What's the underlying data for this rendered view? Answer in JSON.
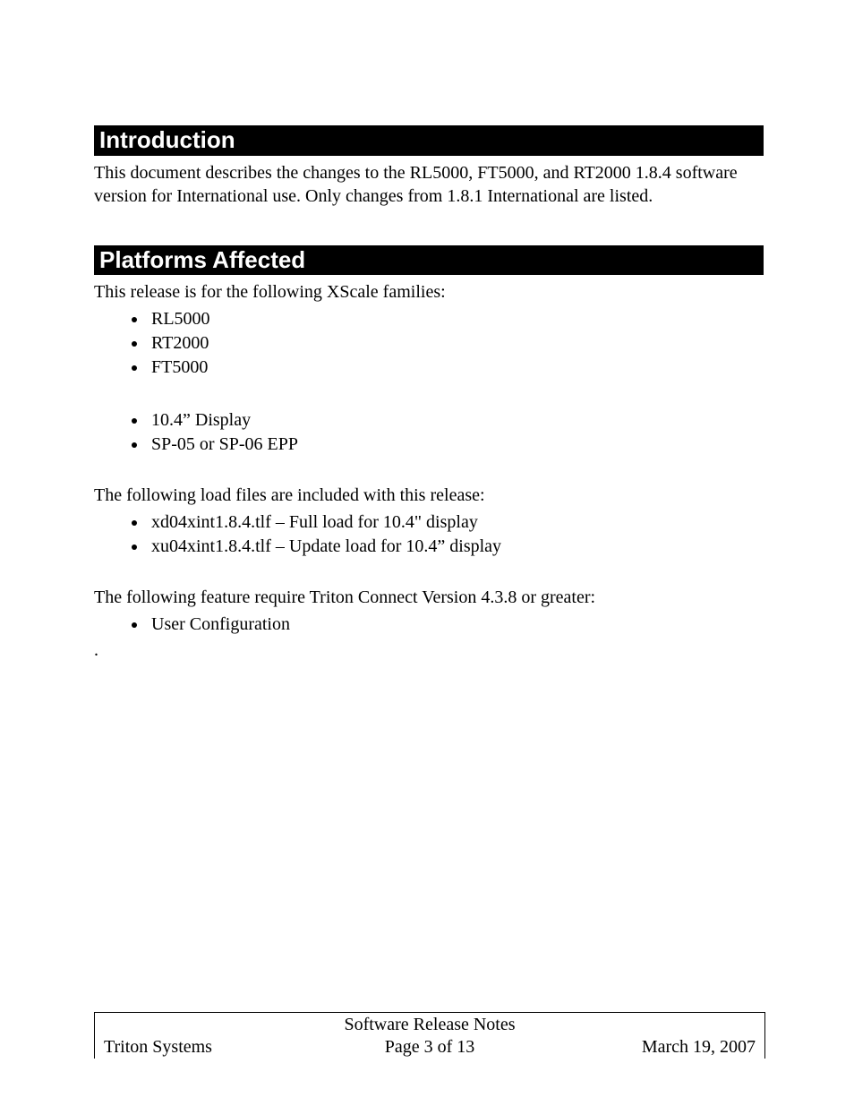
{
  "sections": {
    "intro": {
      "heading": "Introduction",
      "para": "This document describes the changes to the RL5000, FT5000, and RT2000 1.8.4 software version for International use.  Only changes from 1.8.1 International are listed."
    },
    "platforms": {
      "heading": "Platforms Affected",
      "para1": "This release is for the following XScale families:",
      "list1": [
        "RL5000",
        "RT2000",
        "FT5000"
      ],
      "list2": [
        "10.4” Display",
        "SP-05 or SP-06 EPP"
      ],
      "para2": "The following load files are included with this release:",
      "list3": [
        "xd04xint1.8.4.tlf – Full load for 10.4\" display",
        "xu04xint1.8.4.tlf – Update load for 10.4” display"
      ],
      "para3": "The following feature require Triton Connect Version 4.3.8 or greater:",
      "list4": [
        "User Configuration"
      ],
      "trailing_dot": "."
    }
  },
  "footer": {
    "title": "Software Release Notes",
    "left": "Triton Systems",
    "center": "Page 3 of 13",
    "right": "March 19, 2007"
  }
}
